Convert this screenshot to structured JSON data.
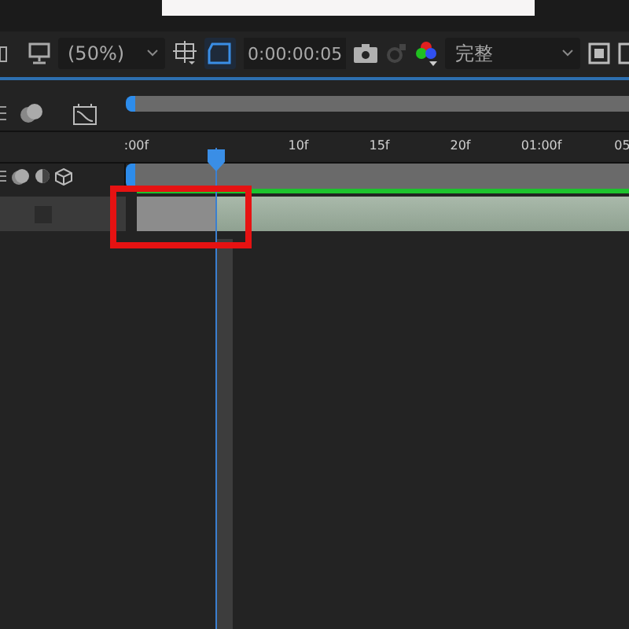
{
  "toolbar": {
    "zoom": "(50%)",
    "timecode": "0:00:00:05",
    "quality": "完整"
  },
  "ruler": {
    "labels": [
      ":00f",
      "10f",
      "15f",
      "20f",
      "01:00f",
      "05"
    ]
  }
}
